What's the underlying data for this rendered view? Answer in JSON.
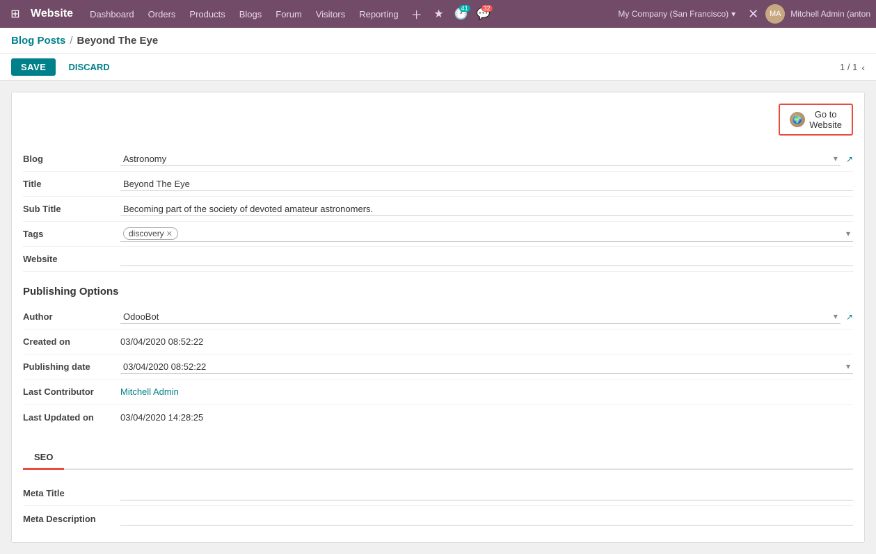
{
  "topnav": {
    "app_name": "Website",
    "nav_links": [
      "Dashboard",
      "Orders",
      "Products",
      "Blogs",
      "Forum",
      "Visitors",
      "Reporting"
    ],
    "counter_1": "41",
    "counter_2": "32",
    "company": "My Company (San Francisco)",
    "user": "Mitchell Admin (anton"
  },
  "breadcrumb": {
    "parent": "Blog Posts",
    "current": "Beyond The Eye"
  },
  "actions": {
    "save": "SAVE",
    "discard": "DISCARD",
    "pagination": "1 / 1"
  },
  "goto_website": {
    "label": "Go to\nWebsite"
  },
  "form": {
    "blog_label": "Blog",
    "blog_value": "Astronomy",
    "title_label": "Title",
    "title_value": "Beyond The Eye",
    "subtitle_label": "Sub Title",
    "subtitle_value": "Becoming part of the society of devoted amateur astronomers.",
    "tags_label": "Tags",
    "tag_value": "discovery",
    "website_label": "Website"
  },
  "publishing": {
    "section_title": "Publishing Options",
    "author_label": "Author",
    "author_value": "OdooBot",
    "created_label": "Created on",
    "created_value": "03/04/2020 08:52:22",
    "pub_date_label": "Publishing date",
    "pub_date_value": "03/04/2020 08:52:22",
    "contributor_label": "Last Contributor",
    "contributor_value": "Mitchell Admin",
    "updated_label": "Last Updated on",
    "updated_value": "03/04/2020 14:28:25"
  },
  "seo": {
    "tab_label": "SEO",
    "meta_title_label": "Meta Title",
    "meta_desc_label": "Meta Description"
  }
}
